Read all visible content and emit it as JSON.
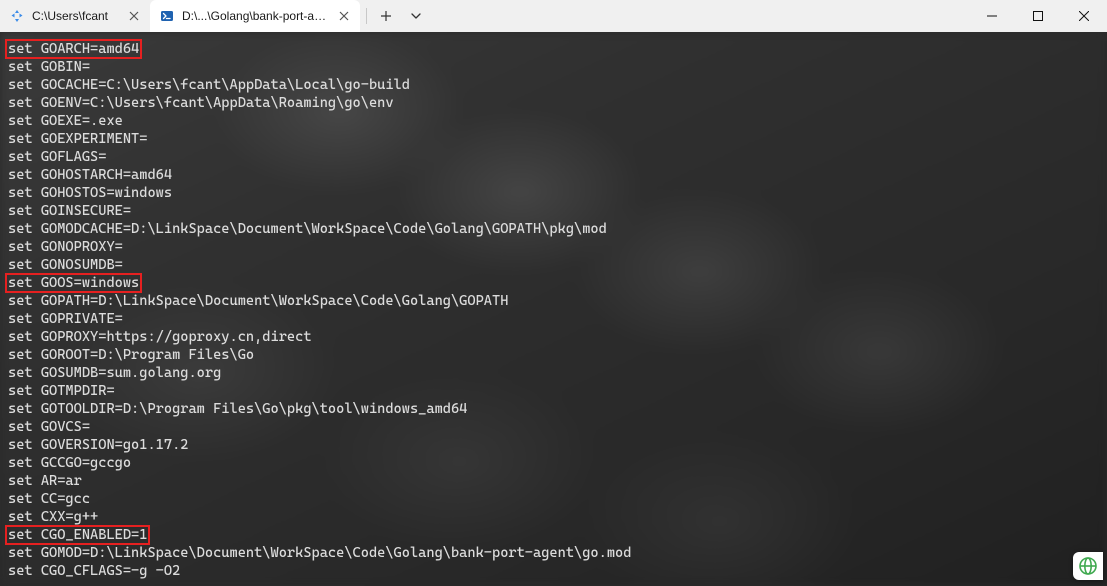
{
  "tabs": [
    {
      "title": "C:\\Users\\fcant",
      "active": false,
      "icon": "segments-icon"
    },
    {
      "title": "D:\\...\\Golang\\bank-port-agent",
      "active": true,
      "icon": "powershell-icon"
    }
  ],
  "terminal": {
    "lines": [
      {
        "text": "set GOARCH=amd64",
        "highlighted": true
      },
      {
        "text": "set GOBIN=",
        "highlighted": false
      },
      {
        "text": "set GOCACHE=C:\\Users\\fcant\\AppData\\Local\\go-build",
        "highlighted": false
      },
      {
        "text": "set GOENV=C:\\Users\\fcant\\AppData\\Roaming\\go\\env",
        "highlighted": false
      },
      {
        "text": "set GOEXE=.exe",
        "highlighted": false
      },
      {
        "text": "set GOEXPERIMENT=",
        "highlighted": false
      },
      {
        "text": "set GOFLAGS=",
        "highlighted": false
      },
      {
        "text": "set GOHOSTARCH=amd64",
        "highlighted": false
      },
      {
        "text": "set GOHOSTOS=windows",
        "highlighted": false
      },
      {
        "text": "set GOINSECURE=",
        "highlighted": false
      },
      {
        "text": "set GOMODCACHE=D:\\LinkSpace\\Document\\WorkSpace\\Code\\Golang\\GOPATH\\pkg\\mod",
        "highlighted": false
      },
      {
        "text": "set GONOPROXY=",
        "highlighted": false
      },
      {
        "text": "set GONOSUMDB=",
        "highlighted": false
      },
      {
        "text": "set GOOS=windows",
        "highlighted": true
      },
      {
        "text": "set GOPATH=D:\\LinkSpace\\Document\\WorkSpace\\Code\\Golang\\GOPATH",
        "highlighted": false
      },
      {
        "text": "set GOPRIVATE=",
        "highlighted": false
      },
      {
        "text": "set GOPROXY=https://goproxy.cn,direct",
        "highlighted": false
      },
      {
        "text": "set GOROOT=D:\\Program Files\\Go",
        "highlighted": false
      },
      {
        "text": "set GOSUMDB=sum.golang.org",
        "highlighted": false
      },
      {
        "text": "set GOTMPDIR=",
        "highlighted": false
      },
      {
        "text": "set GOTOOLDIR=D:\\Program Files\\Go\\pkg\\tool\\windows_amd64",
        "highlighted": false
      },
      {
        "text": "set GOVCS=",
        "highlighted": false
      },
      {
        "text": "set GOVERSION=go1.17.2",
        "highlighted": false
      },
      {
        "text": "set GCCGO=gccgo",
        "highlighted": false
      },
      {
        "text": "set AR=ar",
        "highlighted": false
      },
      {
        "text": "set CC=gcc",
        "highlighted": false
      },
      {
        "text": "set CXX=g++",
        "highlighted": false
      },
      {
        "text": "set CGO_ENABLED=1",
        "highlighted": true
      },
      {
        "text": "set GOMOD=D:\\LinkSpace\\Document\\WorkSpace\\Code\\Golang\\bank-port-agent\\go.mod",
        "highlighted": false
      },
      {
        "text": "set CGO_CFLAGS=-g -O2",
        "highlighted": false
      }
    ]
  },
  "colors": {
    "highlight_border": "#e62020",
    "terminal_text": "#dcdcdc",
    "titlebar_bg": "#f0f0f0",
    "active_tab_bg": "#ffffff"
  }
}
